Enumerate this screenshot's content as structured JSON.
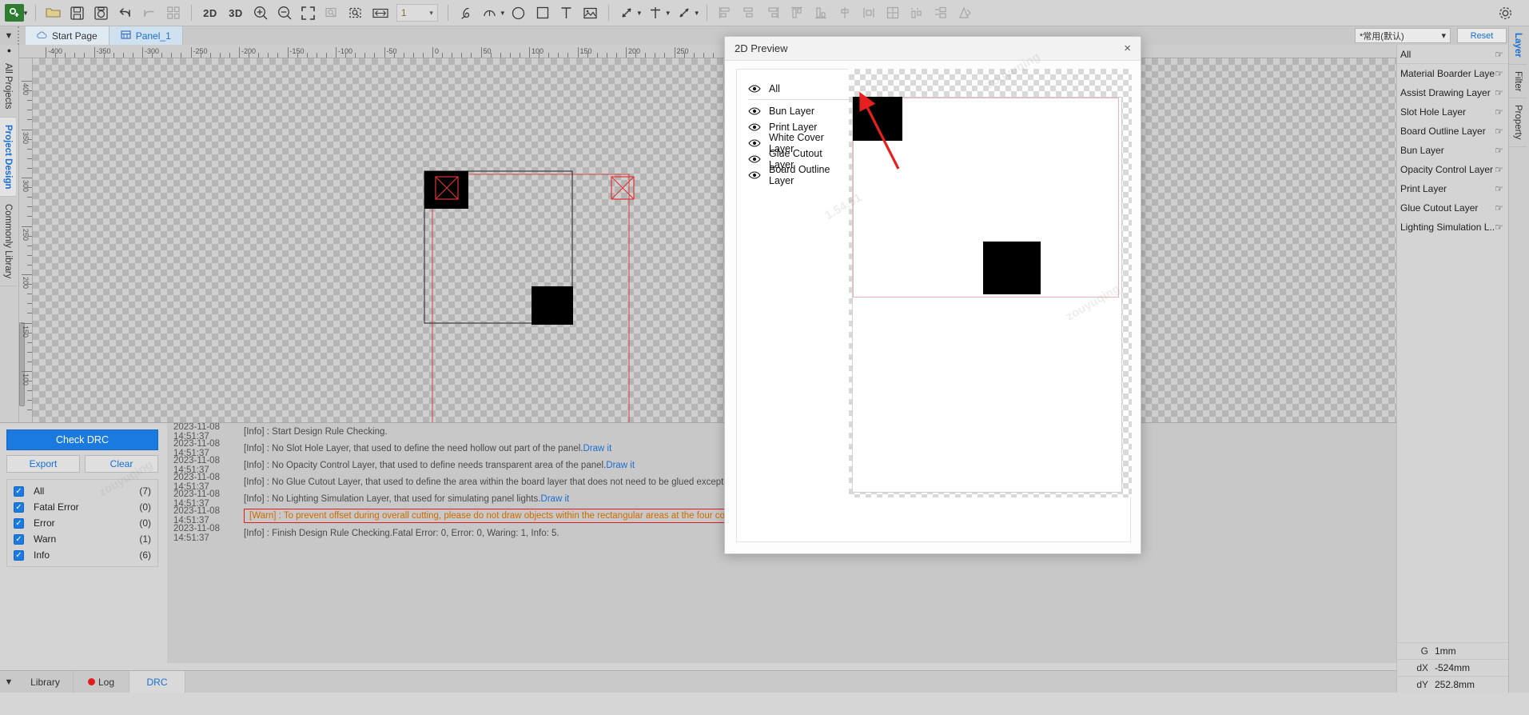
{
  "toolbar": {
    "logo": "app-logo",
    "items": [
      {
        "name": "open-file",
        "glyph": "⬜",
        "label": "Open"
      },
      {
        "name": "save",
        "glyph": "💾",
        "label": "Save"
      },
      {
        "name": "save-as",
        "glyph": "🖫",
        "label": "Save As"
      },
      {
        "name": "undo",
        "glyph": "↶",
        "label": "Undo"
      },
      {
        "name": "redo",
        "glyph": "↷",
        "label": "Redo"
      },
      {
        "name": "grid",
        "glyph": "░",
        "label": "Grid"
      }
    ],
    "view_2d": "2D",
    "view_3d": "3D",
    "zoom_in": "⊕",
    "zoom_out": "⊖",
    "fit_screen": "⛶",
    "zoom_region": "⌕",
    "zoom_select": "⌕",
    "measure": "⇔",
    "layer_value": "1",
    "draw_tools": [
      "pen-tool",
      "arc-tool",
      "circle-tool",
      "rect-tool",
      "text-tool",
      "image-tool"
    ],
    "dimension_tools": [
      "dim-angle-tool",
      "dim-cross-tool",
      "dim-line-tool"
    ],
    "align_tools": [
      "align-left",
      "align-center-h",
      "align-right",
      "align-top",
      "align-middle",
      "align-bottom",
      "distribute-h",
      "distribute-v",
      "group",
      "ungroup",
      "mirror"
    ],
    "settings": "⚙"
  },
  "tabstrip": {
    "tabs": [
      {
        "label": "Start Page",
        "icon": "cloud-icon",
        "active": false
      },
      {
        "label": "Panel_1",
        "icon": "panel-icon",
        "active": true
      }
    ],
    "preset_value": "*常用(默认)",
    "reset_label": "Reset"
  },
  "left_rail": {
    "tabs": [
      {
        "label": "All Projects",
        "active": false
      },
      {
        "label": "Project Design",
        "active": true
      },
      {
        "label": "Commonly Library",
        "active": false
      }
    ]
  },
  "rulers": {
    "horizontal": [
      "-400",
      "-350",
      "-300",
      "-250",
      "-200",
      "-150",
      "-100",
      "-50",
      "0",
      "50",
      "100",
      "150",
      "200",
      "250"
    ],
    "vertical": [
      "400",
      "350",
      "300",
      "250",
      "200",
      "150",
      "100"
    ]
  },
  "dialog": {
    "title": "2D Preview",
    "close_label": "×",
    "layers": [
      {
        "label": "All",
        "icon": "eye-icon"
      },
      {
        "label": "Bun Layer",
        "icon": "eye-icon"
      },
      {
        "label": "Print Layer",
        "icon": "eye-icon"
      },
      {
        "label": "White Cover Layer",
        "icon": "eye-icon"
      },
      {
        "label": "Glue Cutout Layer",
        "icon": "eye-icon"
      },
      {
        "label": "Board Outline Layer",
        "icon": "eye-icon"
      }
    ]
  },
  "right_panel": {
    "layers": [
      {
        "label": "All",
        "hand": false
      },
      {
        "label": "Material Boarder Layer",
        "hand": false
      },
      {
        "label": "Assist Drawing Layer",
        "hand": true
      },
      {
        "label": "Slot Hole Layer",
        "hand": true
      },
      {
        "label": "Board Outline Layer",
        "hand": true
      },
      {
        "label": "Bun Layer",
        "hand": true
      },
      {
        "label": "Opacity Control Layer",
        "hand": true
      },
      {
        "label": "Print Layer",
        "hand": true
      },
      {
        "label": "Glue Cutout Layer",
        "hand": true
      },
      {
        "label": "Lighting Simulation L...",
        "hand": true
      }
    ],
    "values": [
      {
        "key": "G",
        "value": "1mm"
      },
      {
        "key": "dX",
        "value": "-524mm"
      },
      {
        "key": "dY",
        "value": "252.8mm"
      }
    ],
    "rail_tabs": [
      {
        "label": "Layer",
        "active": true
      },
      {
        "label": "Filter",
        "active": false
      },
      {
        "label": "Property",
        "active": false
      }
    ]
  },
  "drc": {
    "check_button": "Check DRC",
    "export_button": "Export",
    "clear_button": "Clear",
    "filters": [
      {
        "label": "All",
        "count": "(7)",
        "checked": true
      },
      {
        "label": "Fatal Error",
        "count": "(0)",
        "checked": true
      },
      {
        "label": "Error",
        "count": "(0)",
        "checked": true
      },
      {
        "label": "Warn",
        "count": "(1)",
        "checked": true
      },
      {
        "label": "Info",
        "count": "(6)",
        "checked": true
      }
    ],
    "log": [
      {
        "ts": "2023-11-08 14:51:37",
        "level": "Info",
        "msg": "[Info] : Start Design Rule Checking.",
        "link": "",
        "type": "info"
      },
      {
        "ts": "2023-11-08 14:51:37",
        "level": "Info",
        "msg": "[Info] : No Slot Hole Layer, that used to define the need hollow out part of the panel.",
        "link": "Draw it",
        "type": "info"
      },
      {
        "ts": "2023-11-08 14:51:37",
        "level": "Info",
        "msg": "[Info] : No Opacity Control Layer, that used to define needs transparent area of the panel.",
        "link": "Draw it",
        "type": "info"
      },
      {
        "ts": "2023-11-08 14:51:37",
        "level": "Info",
        "msg": "[Info] : No Glue Cutout Layer, that used to define the area within the board layer that does not need to be glued except for the board hole.",
        "link": "Draw it",
        "type": "info"
      },
      {
        "ts": "2023-11-08 14:51:37",
        "level": "Info",
        "msg": "[Info] : No Lighting Simulation Layer, that used for simulating panel lights.",
        "link": "Draw it",
        "type": "info"
      },
      {
        "ts": "2023-11-08 14:51:37",
        "level": "Warn",
        "msg": "[Warn] : To prevent offset during overall cutting, please do not draw objects within the rectangular areas at the four corners of the material board.",
        "link": "",
        "type": "warn"
      },
      {
        "ts": "2023-11-08 14:51:37",
        "level": "Info",
        "msg": "[Info] : Finish Design Rule Checking.Fatal Error: 0, Error: 0, Waring: 1, Info: 5.",
        "link": "",
        "type": "info"
      }
    ],
    "bottom_tabs": [
      {
        "label": "Library",
        "active": false,
        "dot": false
      },
      {
        "label": "Log",
        "active": false,
        "dot": true
      },
      {
        "label": "DRC",
        "active": true,
        "dot": false
      }
    ]
  },
  "watermarks": [
    "zouyuqing",
    "4.51",
    "52",
    "zouyuqing",
    "1.54.51"
  ]
}
